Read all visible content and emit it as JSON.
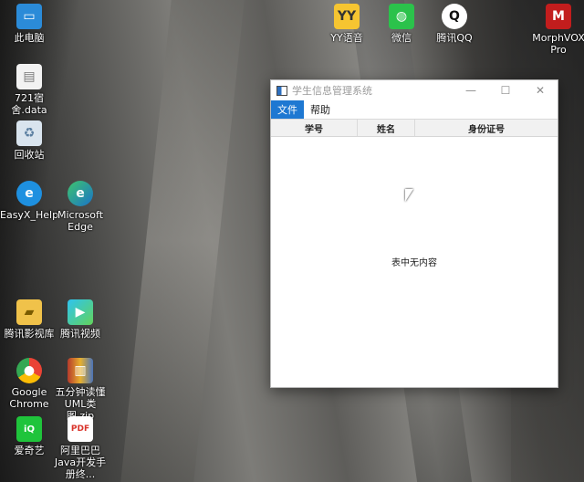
{
  "desktop_icons": [
    {
      "label": "此电脑",
      "icon": "computer-icon"
    },
    {
      "label": "721宿舍.data",
      "icon": "file-icon"
    },
    {
      "label": "回收站",
      "icon": "recycle-bin-icon"
    },
    {
      "label": "EasyX_Help",
      "icon": "easyx-icon"
    },
    {
      "label": "Microsoft Edge",
      "icon": "edge-icon"
    },
    {
      "label": "腾讯影视库",
      "icon": "folder-icon"
    },
    {
      "label": "腾讯视频",
      "icon": "tencent-video-icon"
    },
    {
      "label": "Google Chrome",
      "icon": "chrome-icon"
    },
    {
      "label": "五分钟读懂UML类图.zip",
      "icon": "zip-icon"
    },
    {
      "label": "爱奇艺",
      "icon": "iqiyi-icon"
    },
    {
      "label": "阿里巴巴Java开发手册终...",
      "icon": "pdf-icon"
    },
    {
      "label": "YY语音",
      "icon": "yy-icon"
    },
    {
      "label": "微信",
      "icon": "wechat-icon"
    },
    {
      "label": "腾讯QQ",
      "icon": "qq-icon"
    },
    {
      "label": "MorphVOX Pro",
      "icon": "morphvox-icon"
    }
  ],
  "window": {
    "title": "学生信息管理系统",
    "controls": {
      "minimize": "—",
      "maximize": "☐",
      "close": "✕"
    },
    "menus": [
      "文件",
      "帮助"
    ],
    "columns": [
      "学号",
      "姓名",
      "身份证号"
    ],
    "empty_message": "表中无内容"
  },
  "colors": {
    "menu_active": "#1e78d2"
  }
}
